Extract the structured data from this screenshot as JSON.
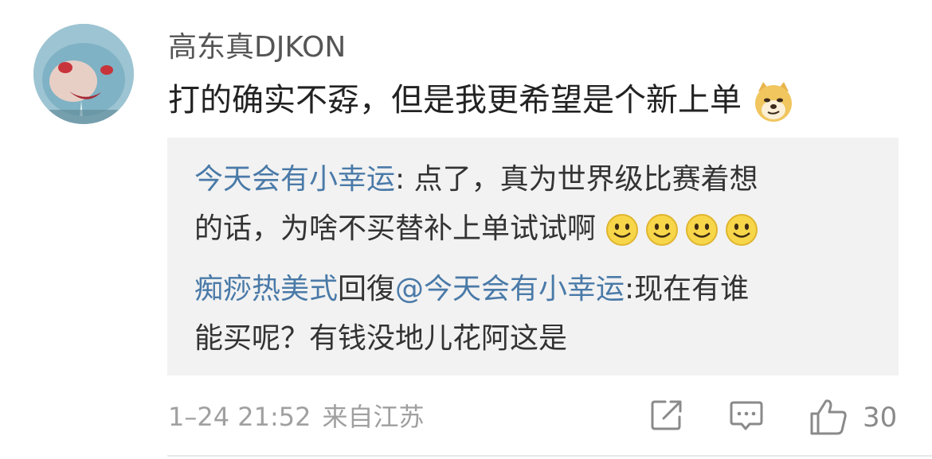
{
  "comment": {
    "author": "高东真DJKON",
    "text": "打的确实不孬，但是我更希望是个新上单",
    "emoji_icon": "doge-icon"
  },
  "replies": [
    {
      "author": "今天会有小幸运",
      "text_line1": ": 点了，真为世界级比赛着想",
      "text_line2": "的话，为啥不买替补上单试试啊",
      "emoji_icon": "smile-icon"
    },
    {
      "author": "痴痧热美式",
      "reply_word": "回復",
      "mention": "@今天会有小幸运",
      "text_line1": ":现在有谁",
      "text_line2": "能买呢？有钱没地儿花阿这是"
    }
  ],
  "footer": {
    "timestamp": "1–24 21:52",
    "location": "来自江苏",
    "share_icon": "share-icon",
    "comment_icon": "comment-icon",
    "like_icon": "thumbs-up-icon",
    "like_count": "30"
  },
  "colors": {
    "link": "#4a7aa8",
    "reply_background": "#f2f2f2",
    "muted_text": "#a0a0a0"
  }
}
